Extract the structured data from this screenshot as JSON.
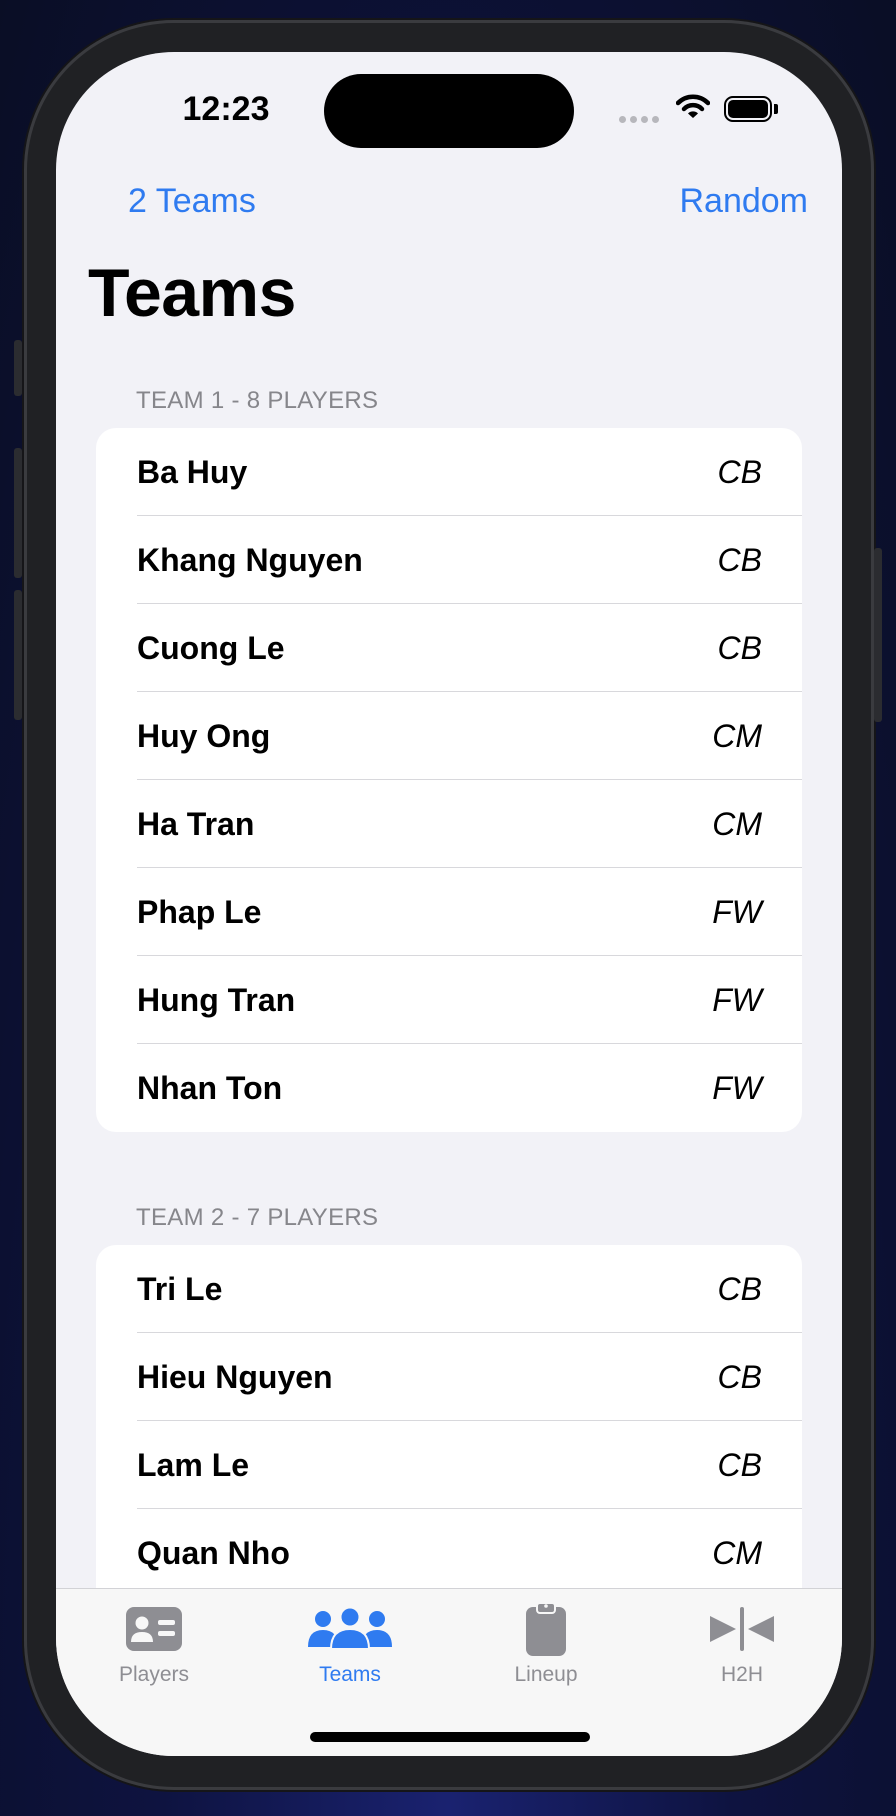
{
  "status": {
    "time": "12:23"
  },
  "nav": {
    "left_label": "2 Teams",
    "right_label": "Random",
    "title": "Teams"
  },
  "teams": [
    {
      "header": "TEAM 1 - 8 PLAYERS",
      "players": [
        {
          "name": "Ba Huy",
          "position": "CB"
        },
        {
          "name": "Khang Nguyen",
          "position": "CB"
        },
        {
          "name": "Cuong Le",
          "position": "CB"
        },
        {
          "name": "Huy Ong",
          "position": "CM"
        },
        {
          "name": "Ha Tran",
          "position": "CM"
        },
        {
          "name": "Phap Le",
          "position": "FW"
        },
        {
          "name": "Hung Tran",
          "position": "FW"
        },
        {
          "name": "Nhan Ton",
          "position": "FW"
        }
      ]
    },
    {
      "header": "TEAM 2 - 7 PLAYERS",
      "players": [
        {
          "name": "Tri Le",
          "position": "CB"
        },
        {
          "name": "Hieu Nguyen",
          "position": "CB"
        },
        {
          "name": "Lam Le",
          "position": "CB"
        },
        {
          "name": "Quan Nho",
          "position": "CM"
        }
      ]
    }
  ],
  "tabs": [
    {
      "label": "Players",
      "icon": "person-card-icon",
      "active": false
    },
    {
      "label": "Teams",
      "icon": "three-people-icon",
      "active": true
    },
    {
      "label": "Lineup",
      "icon": "clipboard-icon",
      "active": false
    },
    {
      "label": "H2H",
      "icon": "head-to-head-icon",
      "active": false
    }
  ],
  "colors": {
    "accent": "#2f7bf0",
    "inactive": "#8e8e93",
    "background": "#f2f2f7"
  }
}
